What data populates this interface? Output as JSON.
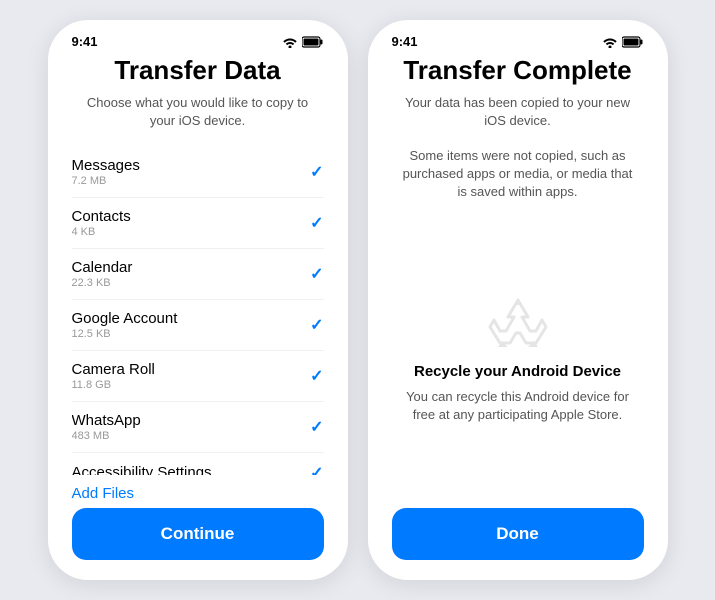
{
  "phone_left": {
    "status_bar": {
      "time": "9:41",
      "wifi": "wifi",
      "battery": "battery"
    },
    "title": "Transfer Data",
    "subtitle": "Choose what you would like to copy to your iOS device.",
    "items": [
      {
        "name": "Messages",
        "size": "7.2 MB",
        "checked": true
      },
      {
        "name": "Contacts",
        "size": "4 KB",
        "checked": true
      },
      {
        "name": "Calendar",
        "size": "22.3 KB",
        "checked": true
      },
      {
        "name": "Google Account",
        "size": "12.5 KB",
        "checked": true
      },
      {
        "name": "Camera Roll",
        "size": "11.8 GB",
        "checked": true
      },
      {
        "name": "WhatsApp",
        "size": "483 MB",
        "checked": true
      },
      {
        "name": "Accessibility Settings",
        "size": "",
        "checked": true
      }
    ],
    "add_files_label": "Add Files",
    "continue_label": "Continue"
  },
  "phone_right": {
    "status_bar": {
      "time": "9:41",
      "wifi": "wifi",
      "battery": "battery"
    },
    "title": "Transfer Complete",
    "subtitle": "Your data has been copied to your new iOS device.",
    "note": "Some items were not copied, such as purchased apps or media, or media that is saved within apps.",
    "recycle_title": "Recycle your Android Device",
    "recycle_desc": "You can recycle this Android device for free at any participating Apple Store.",
    "done_label": "Done"
  }
}
